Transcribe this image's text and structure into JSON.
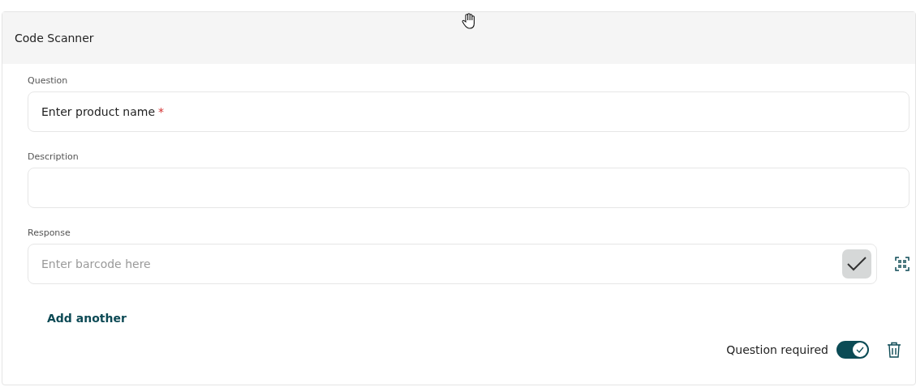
{
  "card": {
    "title": "Code Scanner"
  },
  "fields": [
    {
      "label": "Question",
      "value": "Enter product name",
      "required_mark": "*"
    },
    {
      "label": "Description"
    }
  ],
  "response": {
    "label": "Response",
    "placeholder": "Enter barcode here"
  },
  "add_another": "Add another",
  "footer": {
    "required_label": "Question required",
    "required_on": true
  }
}
